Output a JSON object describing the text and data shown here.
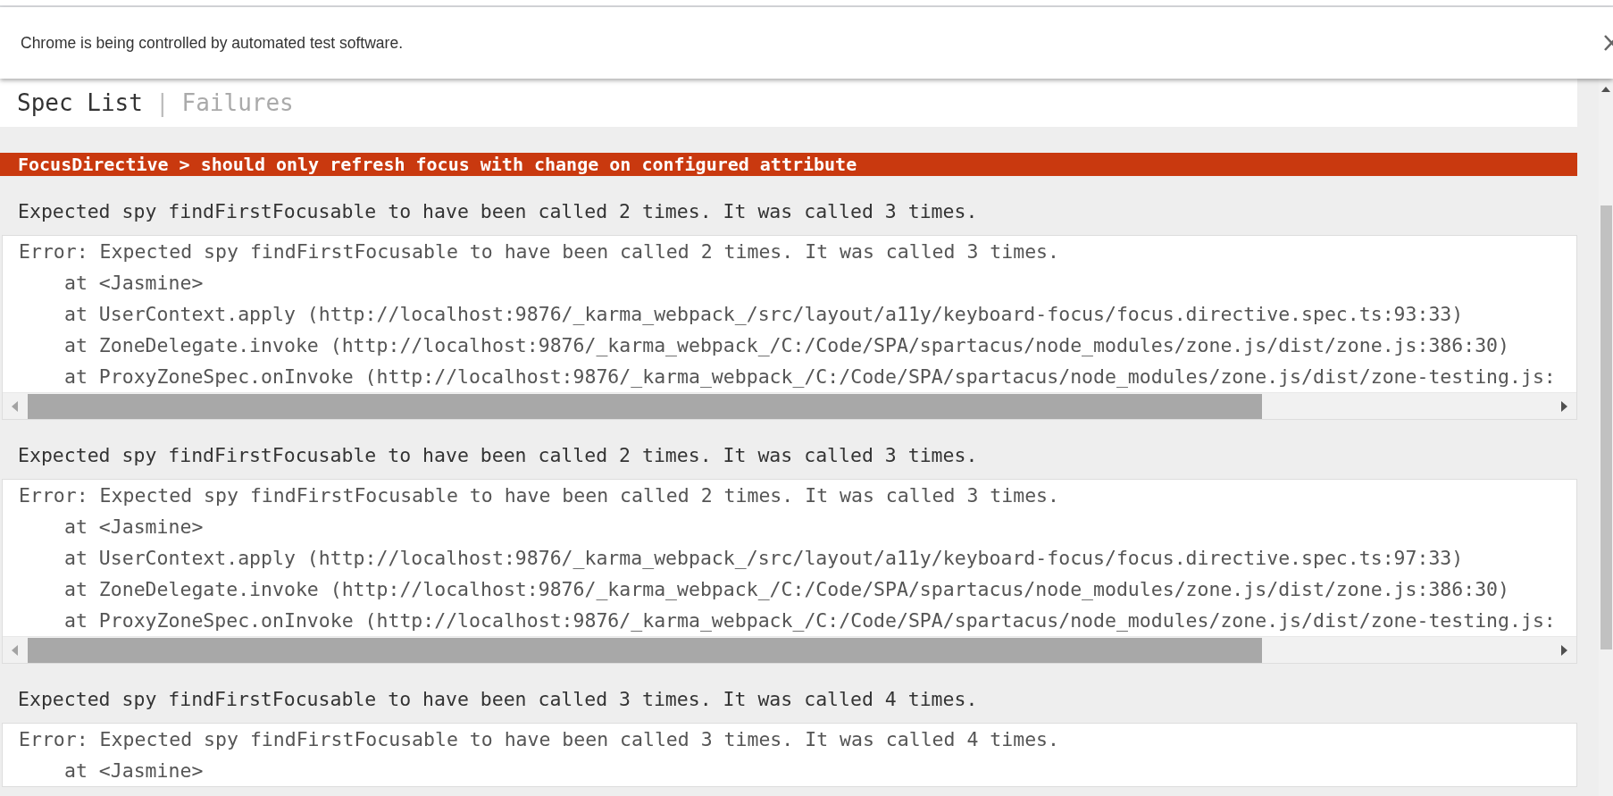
{
  "infobar": {
    "message": "Chrome is being controlled by automated test software."
  },
  "tabs": [
    {
      "label": "Spec List",
      "selected": true
    },
    {
      "label": "Failures",
      "selected": false
    }
  ],
  "tab_separator": "|",
  "failure": {
    "title": "FocusDirective > should only refresh focus with change on configured attribute",
    "results": [
      {
        "message": "Expected spy findFirstFocusable to have been called 2 times. It was called 3 times.",
        "stack": [
          "Error: Expected spy findFirstFocusable to have been called 2 times. It was called 3 times.",
          "at <Jasmine>",
          "at UserContext.apply (http://localhost:9876/_karma_webpack_/src/layout/a11y/keyboard-focus/focus.directive.spec.ts:93:33)",
          "at ZoneDelegate.invoke (http://localhost:9876/_karma_webpack_/C:/Code/SPA/spartacus/node_modules/zone.js/dist/zone.js:386:30)",
          "at ProxyZoneSpec.onInvoke (http://localhost:9876/_karma_webpack_/C:/Code/SPA/spartacus/node_modules/zone.js/dist/zone-testing.js:"
        ]
      },
      {
        "message": "Expected spy findFirstFocusable to have been called 2 times. It was called 3 times.",
        "stack": [
          "Error: Expected spy findFirstFocusable to have been called 2 times. It was called 3 times.",
          "at <Jasmine>",
          "at UserContext.apply (http://localhost:9876/_karma_webpack_/src/layout/a11y/keyboard-focus/focus.directive.spec.ts:97:33)",
          "at ZoneDelegate.invoke (http://localhost:9876/_karma_webpack_/C:/Code/SPA/spartacus/node_modules/zone.js/dist/zone.js:386:30)",
          "at ProxyZoneSpec.onInvoke (http://localhost:9876/_karma_webpack_/C:/Code/SPA/spartacus/node_modules/zone.js/dist/zone-testing.js:"
        ]
      },
      {
        "message": "Expected spy findFirstFocusable to have been called 3 times. It was called 4 times.",
        "stack": [
          "Error: Expected spy findFirstFocusable to have been called 3 times. It was called 4 times.",
          "at <Jasmine>"
        ]
      }
    ]
  }
}
